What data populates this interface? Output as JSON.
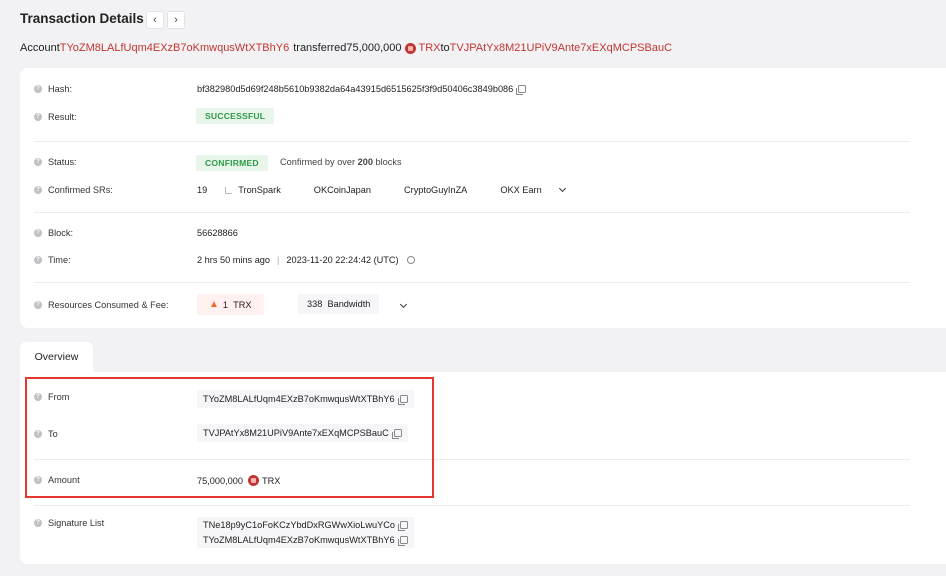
{
  "header": {
    "title": "Transaction Details"
  },
  "summary": {
    "account_label": "Account",
    "from_address": "TYoZM8LALfUqm4EXzB7oKmwqusWtXTBhY6",
    "action": "transferred",
    "amount": "75,000,000",
    "token": "TRX",
    "to_label": "to",
    "to_address": "TVJPAtYx8M21UPiV9Ante7xEXqMCPSBauC"
  },
  "details": {
    "hash_label": "Hash:",
    "hash_value": "bf382980d5d69f248b5610b9382da64a43915d6515625f3f9d50406c3849b086",
    "result_label": "Result:",
    "result_value": "SUCCESSFUL",
    "status_label": "Status:",
    "status_value": "CONFIRMED",
    "status_note_prefix": "Confirmed by over",
    "status_note_count": "200",
    "status_note_suffix": "blocks",
    "srs_label": "Confirmed SRs:",
    "srs_count": "19",
    "srs": [
      "TronSpark",
      "OKCoinJapan",
      "CryptoGuyInZA",
      "OKX Earn"
    ],
    "block_label": "Block:",
    "block_value": "56628866",
    "time_label": "Time:",
    "time_ago": "2 hrs 50 mins ago",
    "time_sep": "|",
    "time_utc": "2023-11-20 22:24:42 (UTC)",
    "fee_label": "Resources Consumed & Fee:",
    "fee_amount": "1",
    "fee_token": "TRX",
    "bandwidth_amount": "338",
    "bandwidth_label": "Bandwidth"
  },
  "tabs": {
    "overview": "Overview"
  },
  "overview": {
    "from_label": "From",
    "from_value": "TYoZM8LALfUqm4EXzB7oKmwqusWtXTBhY6",
    "to_label": "To",
    "to_value": "TVJPAtYx8M21UPiV9Ante7xEXqMCPSBauC",
    "amount_label": "Amount",
    "amount_value": "75,000,000",
    "amount_token": "TRX",
    "signature_label": "Signature List",
    "signatures": [
      "TNe18p9yC1oFoKCzYbdDxRGWwXioLwuYCo",
      "TYoZM8LALfUqm4EXzB7oKmwqusWtXTBhY6"
    ]
  },
  "colors": {
    "accent_red": "#c23631",
    "success_green": "#2e9a4a",
    "highlight_red": "#e4372d"
  }
}
